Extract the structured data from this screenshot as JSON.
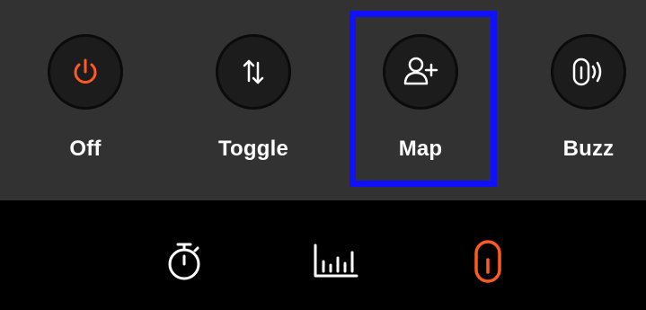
{
  "actions": [
    {
      "label": "Off",
      "icon": "power-icon"
    },
    {
      "label": "Toggle",
      "icon": "toggle-arrows-icon"
    },
    {
      "label": "Map",
      "icon": "add-user-icon"
    },
    {
      "label": "Buzz",
      "icon": "buzz-icon"
    }
  ],
  "selected_action": "Map",
  "tabs": [
    {
      "icon": "stopwatch-icon",
      "active": false
    },
    {
      "icon": "bar-chart-icon",
      "active": false
    },
    {
      "icon": "device-icon",
      "active": true
    }
  ],
  "colors": {
    "accent": "#ff5a1f",
    "panel": "#323232",
    "highlight": "#1010ff",
    "text": "#ffffff"
  }
}
